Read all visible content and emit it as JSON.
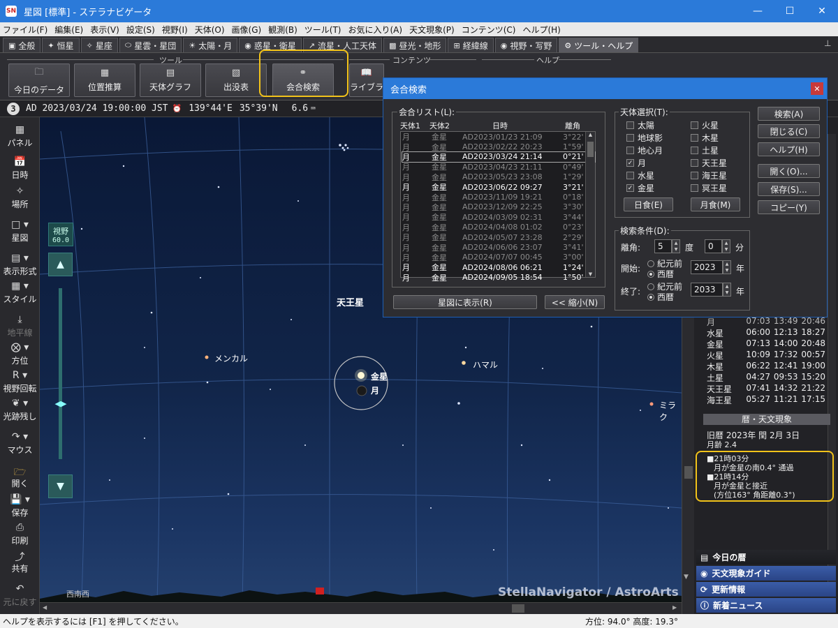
{
  "window": {
    "title": "星図 [標準] - ステラナビゲータ",
    "app_icon": "SN"
  },
  "menubar": [
    "ファイル(F)",
    "編集(E)",
    "表示(V)",
    "設定(S)",
    "視野(I)",
    "天体(O)",
    "画像(G)",
    "観測(B)",
    "ツール(T)",
    "お気に入り(A)",
    "天文現象(P)",
    "コンテンツ(C)",
    "ヘルプ(H)"
  ],
  "tabs": [
    {
      "label": "全般",
      "icon": "window-icon"
    },
    {
      "label": "恒星",
      "icon": "star-icon"
    },
    {
      "label": "星座",
      "icon": "constellation-icon"
    },
    {
      "label": "星雲・星団",
      "icon": "nebula-icon"
    },
    {
      "label": "太陽・月",
      "icon": "sun-icon"
    },
    {
      "label": "惑星・衛星",
      "icon": "planet-icon"
    },
    {
      "label": "流星・人工天体",
      "icon": "meteor-icon"
    },
    {
      "label": "昼光・地形",
      "icon": "landscape-icon"
    },
    {
      "label": "経緯線",
      "icon": "grid-icon"
    },
    {
      "label": "視野・写野",
      "icon": "camera-icon"
    },
    {
      "label": "ツール・ヘルプ",
      "icon": "gear-icon"
    }
  ],
  "ribbon": {
    "group_tools": "ツール",
    "group_contents": "コンテンツ",
    "group_help": "ヘルプ",
    "buttons": [
      "今日のデータ",
      "位置推算",
      "天体グラフ",
      "出没表",
      "会合検索",
      "ライブラ"
    ]
  },
  "infobar": {
    "step": "3",
    "datetime": "AD 2023/03/24 19:00:00 JST",
    "longitude": "139°44'E",
    "latitude": "35°39'N",
    "magnitude": "6.6"
  },
  "lefttoolbar": [
    "パネル",
    "日時",
    "場所",
    "星図",
    "表示形式",
    "スタイル",
    "地平線",
    "方位",
    "視野回転",
    "光跡残し",
    "マウス",
    "開く",
    "保存",
    "印刷",
    "共有",
    "元に戻す"
  ],
  "sky": {
    "fov_label": "視野",
    "fov_value": "60.0",
    "labels": {
      "uranus": "天王星",
      "menkar": "メンカル",
      "hamal": "ハマル",
      "mira": "ミラク",
      "venus": "金星",
      "moon": "月",
      "horizon_dir": "西南西",
      "watermark": "StellaNavigator / AstroArts"
    }
  },
  "dialog": {
    "title": "会合検索",
    "list_label": "会合リスト(L):",
    "columns": [
      "天体1",
      "天体2",
      "日時",
      "離角"
    ],
    "rows": [
      {
        "b1": "月",
        "b2": "金星",
        "dt": "AD2023/01/23  21:09",
        "sep": "3°22'",
        "state": "dim"
      },
      {
        "b1": "月",
        "b2": "金星",
        "dt": "AD2023/02/22  20:23",
        "sep": "1°59'",
        "state": "dim"
      },
      {
        "b1": "月",
        "b2": "金星",
        "dt": "AD2023/03/24  21:14",
        "sep": "0°21'",
        "state": "sel"
      },
      {
        "b1": "月",
        "b2": "金星",
        "dt": "AD2023/04/23  21:11",
        "sep": "0°49'",
        "state": "dim"
      },
      {
        "b1": "月",
        "b2": "金星",
        "dt": "AD2023/05/23  23:08",
        "sep": "1°29'",
        "state": "dim"
      },
      {
        "b1": "月",
        "b2": "金星",
        "dt": "AD2023/06/22  09:27",
        "sep": "3°21'",
        "state": "bright"
      },
      {
        "b1": "月",
        "b2": "金星",
        "dt": "AD2023/11/09  19:21",
        "sep": "0°18'",
        "state": "dim"
      },
      {
        "b1": "月",
        "b2": "金星",
        "dt": "AD2023/12/09  22:25",
        "sep": "3°30'",
        "state": "dim"
      },
      {
        "b1": "月",
        "b2": "金星",
        "dt": "AD2024/03/09  02:31",
        "sep": "3°44'",
        "state": "dim"
      },
      {
        "b1": "月",
        "b2": "金星",
        "dt": "AD2024/04/08  01:02",
        "sep": "0°23'",
        "state": "dim"
      },
      {
        "b1": "月",
        "b2": "金星",
        "dt": "AD2024/05/07  23:28",
        "sep": "2°29'",
        "state": "dim"
      },
      {
        "b1": "月",
        "b2": "金星",
        "dt": "AD2024/06/06  23:07",
        "sep": "3°41'",
        "state": "dim"
      },
      {
        "b1": "月",
        "b2": "金星",
        "dt": "AD2024/07/07  00:45",
        "sep": "3°00'",
        "state": "dim"
      },
      {
        "b1": "月",
        "b2": "金星",
        "dt": "AD2024/08/06  06:21",
        "sep": "1°24'",
        "state": "bright"
      },
      {
        "b1": "月",
        "b2": "金星",
        "dt": "AD2024/09/05  18:54",
        "sep": "1°50'",
        "state": "bright"
      }
    ],
    "show_button": "星図に表示(R)",
    "shrink_button": "<< 縮小(N)",
    "body_select_label": "天体選択(T):",
    "bodies_left": [
      {
        "name": "太陽",
        "checked": false
      },
      {
        "name": "地球影",
        "checked": false
      },
      {
        "name": "地心月",
        "checked": false
      },
      {
        "name": "月",
        "checked": true
      },
      {
        "name": "水星",
        "checked": false
      },
      {
        "name": "金星",
        "checked": true
      }
    ],
    "bodies_right": [
      {
        "name": "火星",
        "checked": false
      },
      {
        "name": "木星",
        "checked": false
      },
      {
        "name": "土星",
        "checked": false
      },
      {
        "name": "天王星",
        "checked": false
      },
      {
        "name": "海王星",
        "checked": false
      },
      {
        "name": "冥王星",
        "checked": false
      }
    ],
    "eclipse_solar": "日食(E)",
    "eclipse_lunar": "月食(M)",
    "cond_label": "検索条件(D):",
    "sep_label": "離角:",
    "sep_deg": "5",
    "deg_unit": "度",
    "sep_min": "0",
    "min_unit": "分",
    "start_label": "開始:",
    "end_label": "終了:",
    "bc": "紀元前",
    "ad": "西暦",
    "start_year": "2023",
    "end_year": "2033",
    "year_unit": "年",
    "side_buttons": [
      "検索(A)",
      "閉じる(C)",
      "ヘルプ(H)",
      "開く(O)...",
      "保存(S)...",
      "コピー(Y)"
    ]
  },
  "rpanel": {
    "times": [
      {
        "name": "月",
        "rise": "07:03",
        "transit": "13:49",
        "set": "20:46"
      },
      {
        "name": "水星",
        "rise": "06:00",
        "transit": "12:13",
        "set": "18:27"
      },
      {
        "name": "金星",
        "rise": "07:13",
        "transit": "14:00",
        "set": "20:48"
      },
      {
        "name": "火星",
        "rise": "10:09",
        "transit": "17:32",
        "set": "00:57"
      },
      {
        "name": "木星",
        "rise": "06:22",
        "transit": "12:41",
        "set": "19:00"
      },
      {
        "name": "土星",
        "rise": "04:27",
        "transit": "09:53",
        "set": "15:20"
      },
      {
        "name": "天王星",
        "rise": "07:41",
        "transit": "14:32",
        "set": "21:22"
      },
      {
        "name": "海王星",
        "rise": "05:27",
        "transit": "11:21",
        "set": "17:15"
      }
    ],
    "calendar_header": "暦・天文現象",
    "lunar_date": "旧暦  2023年 閏 2月 3日",
    "moon_age": "月齢 2.4",
    "events": [
      {
        "time": "■21時03分",
        "text": "月が金星の南0.4°  通過"
      },
      {
        "time": "■21時14分",
        "text": "月が金星と接近",
        "detail": "(方位163°  角距離0.3°)"
      }
    ],
    "nav": [
      "今日の暦",
      "天文現象ガイド",
      "更新情報",
      "新着ニュース"
    ]
  },
  "statusbar": {
    "help": "ヘルプを表示するには [F1] を押してください。",
    "azimuth": "方位:  94.0°  高度:  19.3°"
  }
}
